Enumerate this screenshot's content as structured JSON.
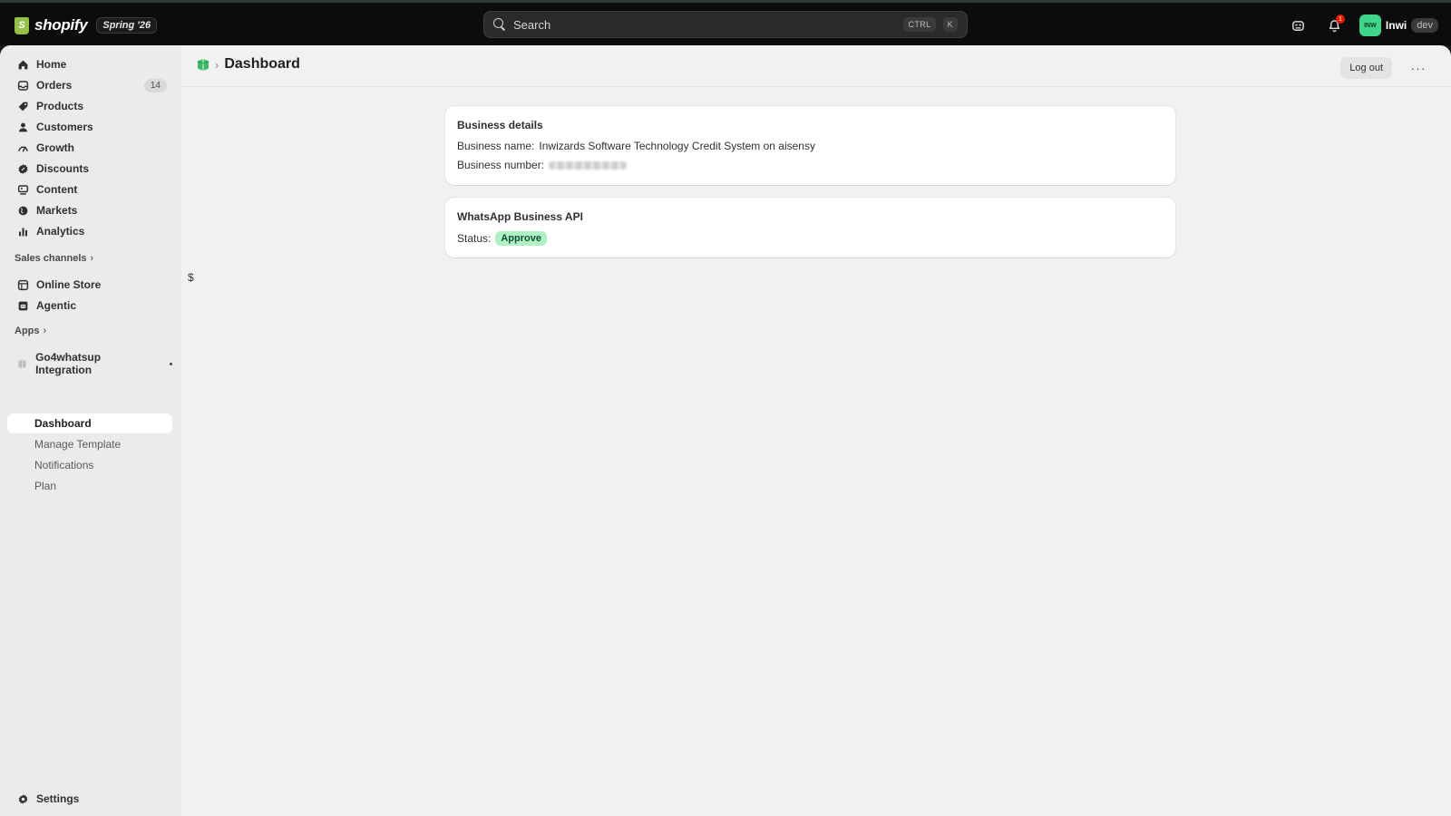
{
  "topbar": {
    "brand_mark": "S",
    "brand_name": "shopify",
    "edition_badge": "Spring '26",
    "search_placeholder": "Search",
    "shortcut_key1": "CTRL",
    "shortcut_key2": "K",
    "notification_count": "1",
    "user_initials": "INW",
    "user_name": "Inwi",
    "user_tag": "dev"
  },
  "sidebar": {
    "main_items": [
      {
        "label": "Home",
        "icon": "home-icon"
      },
      {
        "label": "Orders",
        "icon": "inbox-icon",
        "count": "14"
      },
      {
        "label": "Products",
        "icon": "tag-icon"
      },
      {
        "label": "Customers",
        "icon": "person-icon"
      },
      {
        "label": "Growth",
        "icon": "gauge-icon"
      },
      {
        "label": "Discounts",
        "icon": "discount-icon"
      },
      {
        "label": "Content",
        "icon": "content-icon"
      },
      {
        "label": "Markets",
        "icon": "globe-icon"
      },
      {
        "label": "Analytics",
        "icon": "bar-chart-icon"
      }
    ],
    "sales_channels_label": "Sales channels",
    "sales_channels": [
      {
        "label": "Online Store",
        "icon": "store-icon"
      },
      {
        "label": "Agentic",
        "icon": "agentic-icon"
      }
    ],
    "apps_label": "Apps",
    "app_name": "Go4whatsup Integration",
    "app_pages": [
      "Dashboard",
      "Manage Template",
      "Notifications",
      "Plan"
    ],
    "active_app_page": "Dashboard",
    "settings_label": "Settings"
  },
  "page": {
    "title": "Dashboard",
    "logout_label": "Log out",
    "more_label": "···",
    "stray_text": "$"
  },
  "business_card": {
    "title": "Business details",
    "name_label": "Business name:",
    "name_value": "Inwizards Software Technology Credit System on aisensy",
    "number_label": "Business number:"
  },
  "whatsapp_card": {
    "title": "WhatsApp Business API",
    "status_label": "Status:",
    "status_value": "Approve"
  },
  "colors": {
    "accent_green": "#3fd58a",
    "status_badge_bg": "#aff0c4",
    "status_badge_text": "#0c5132",
    "notification_red": "#e51c00"
  }
}
